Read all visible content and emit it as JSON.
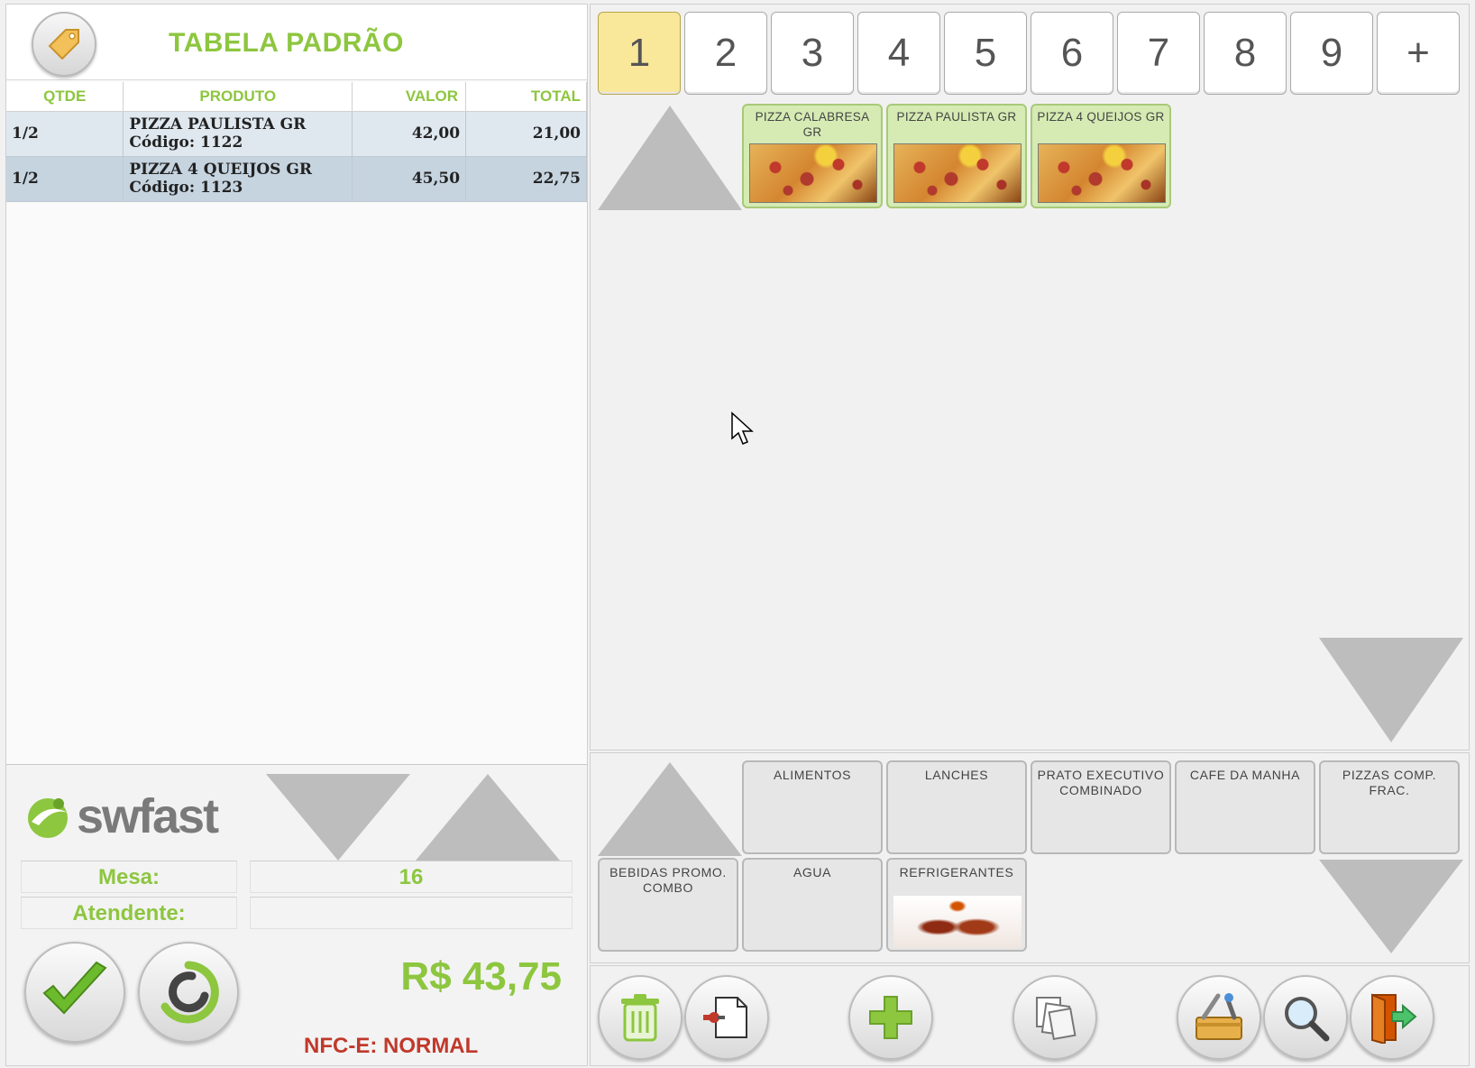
{
  "header": {
    "title": "TABELA PADRÃO",
    "tag_icon": "price-tag-icon"
  },
  "order_table": {
    "columns": [
      "QTDE",
      "PRODUTO",
      "VALOR",
      "TOTAL"
    ],
    "rows": [
      {
        "qty": "1/2",
        "product": "PIZZA PAULISTA GR",
        "code": "Código: 1122",
        "value": "42,00",
        "total": "21,00"
      },
      {
        "qty": "1/2",
        "product": "PIZZA 4 QUEIJOS GR",
        "code": "Código: 1123",
        "value": "45,50",
        "total": "22,75"
      }
    ]
  },
  "brand": {
    "logo_text": "swfast",
    "logo_color": "#8dc63f"
  },
  "info": {
    "mesa_label": "Mesa:",
    "mesa_value": "16",
    "atendente_label": "Atendente:",
    "atendente_value": ""
  },
  "totals": {
    "total": "R$ 43,75",
    "nfce_status": "NFC-E: NORMAL"
  },
  "pages": {
    "tabs": [
      "1",
      "2",
      "3",
      "4",
      "5",
      "6",
      "7",
      "8",
      "9",
      "+"
    ],
    "active": "1"
  },
  "products": [
    {
      "name": "PIZZA CALABRESA GR"
    },
    {
      "name": "PIZZA PAULISTA GR"
    },
    {
      "name": "PIZZA 4 QUEIJOS GR"
    }
  ],
  "categories": [
    {
      "name": "ALIMENTOS"
    },
    {
      "name": "LANCHES"
    },
    {
      "name": "PRATO EXECUTIVO COMBINADO"
    },
    {
      "name": "CAFE DA MANHA"
    },
    {
      "name": "PIZZAS COMP. FRAC."
    },
    {
      "name": "BEBIDAS PROMO. COMBO"
    },
    {
      "name": "AGUA"
    },
    {
      "name": "REFRIGERANTES"
    }
  ],
  "toolbar": {
    "buttons": [
      "trash-icon",
      "document-export-icon",
      "add-icon",
      "copy-documents-icon",
      "tools-icon",
      "search-icon",
      "exit-door-icon"
    ]
  },
  "colors": {
    "accent_green": "#8dc63f",
    "active_tab": "#f9e79a",
    "product_tile": "#d5ebb3",
    "nfce_red": "#c0392b"
  }
}
